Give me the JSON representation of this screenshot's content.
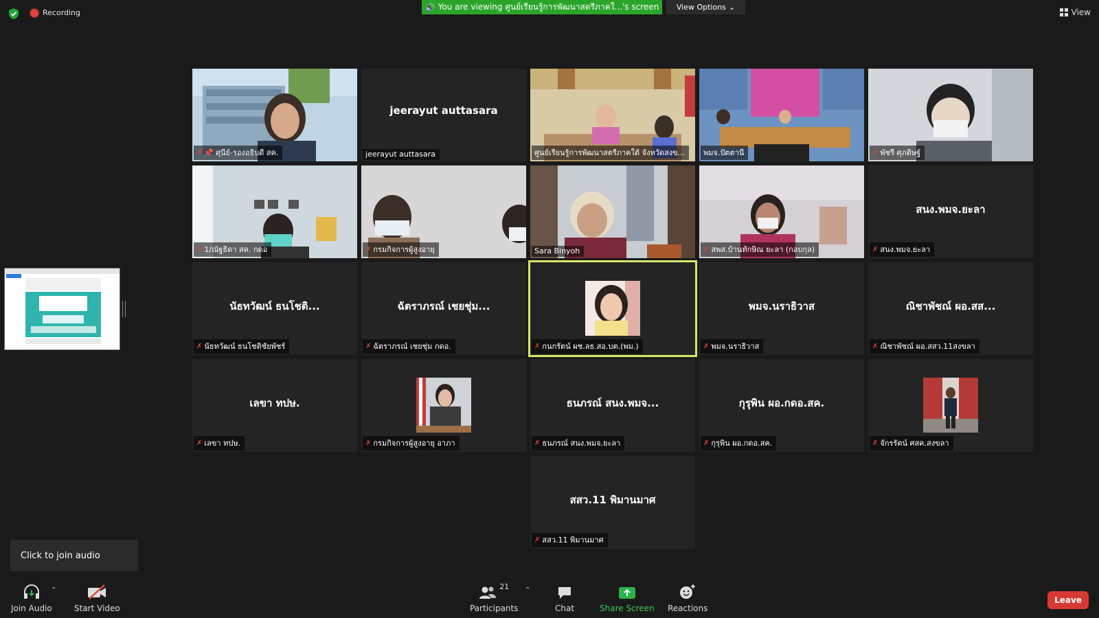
{
  "recording": {
    "label": "Recording"
  },
  "banner": {
    "text": "You are viewing ศูนย์เรียนรู้การพัฒนาสตรีภาคใ...'s screen"
  },
  "view_options": {
    "label": "View Options"
  },
  "view_button": {
    "label": "View"
  },
  "tiles": [
    {
      "label": "ศุนีย์-รองอธิบดี สค."
    },
    {
      "big": "jeerayut auttasara",
      "label": "jeerayut auttasara"
    },
    {
      "label": "ศูนย์เรียนรู้การพัฒนาสตรีภาคใต้ จังหวัดสงข..."
    },
    {
      "label": "พมจ.ปัตตานี"
    },
    {
      "label": "พัชรี ศุภดิษฐ์"
    },
    {
      "label": "1/ณัฐธิดา สค. กดอ"
    },
    {
      "label": "กรมกิจการผู้สูงอายุ"
    },
    {
      "label": "Sara Binyoh"
    },
    {
      "label": "สพส.บ้านทักษิณ ยะลา (กอบกุล)"
    },
    {
      "big": "สนง.พมจ.ยะลา",
      "label": "สนง.พมจ.ยะลา"
    },
    {
      "big": "นัธทวัฒน์ ธนโชติ...",
      "label": "นัธทวัฒน์ ธนโชติชัยพัชร์"
    },
    {
      "big": "ฉัตราภรณ์ เชยชุ่ม...",
      "label": "ฉัตราภรณ์ เชยชุ่ม กดอ."
    },
    {
      "label": "กนกรัตน์ ผช.ลธ.สอ.บต.(พม.)"
    },
    {
      "big": "พมจ.นราธิวาส",
      "label": "พมจ.นราธิวาส"
    },
    {
      "big": "ณิชาพัชณ์ ผอ.สส...",
      "label": "ณิชาพัชณ์ ผอ.สสว.11สงขลา"
    },
    {
      "big": "เลขา ทปษ.",
      "label": "เลขา ทปษ."
    },
    {
      "label": "กรมกิจการผู้สูงอายุ อาภา"
    },
    {
      "big": "ธนภรณ์ สนง.พมจ...",
      "label": "ธนภรณ์ สนง.พมจ.ยะลา"
    },
    {
      "big": "กุรุพิน ผอ.กดอ.สค.",
      "label": "กุรุพิน ผอ.กดอ.สค."
    },
    {
      "label": "จักรรัตน์ ศสค.สงขลา"
    },
    {
      "big": "สสว.11 พิมานมาศ",
      "label": "สสว.11 พิมานมาศ"
    }
  ],
  "join_tooltip": {
    "text": "Click to join audio"
  },
  "toolbar": {
    "join_audio": "Join Audio",
    "start_video": "Start Video",
    "participants": "Participants",
    "participants_count": "21",
    "chat": "Chat",
    "share_screen": "Share Screen",
    "reactions": "Reactions",
    "leave": "Leave"
  },
  "colors": {
    "accent_green": "#2aa52a",
    "leave_red": "#d73a32",
    "active_border": "#d7e86a",
    "mic_off": "#e0453b"
  }
}
